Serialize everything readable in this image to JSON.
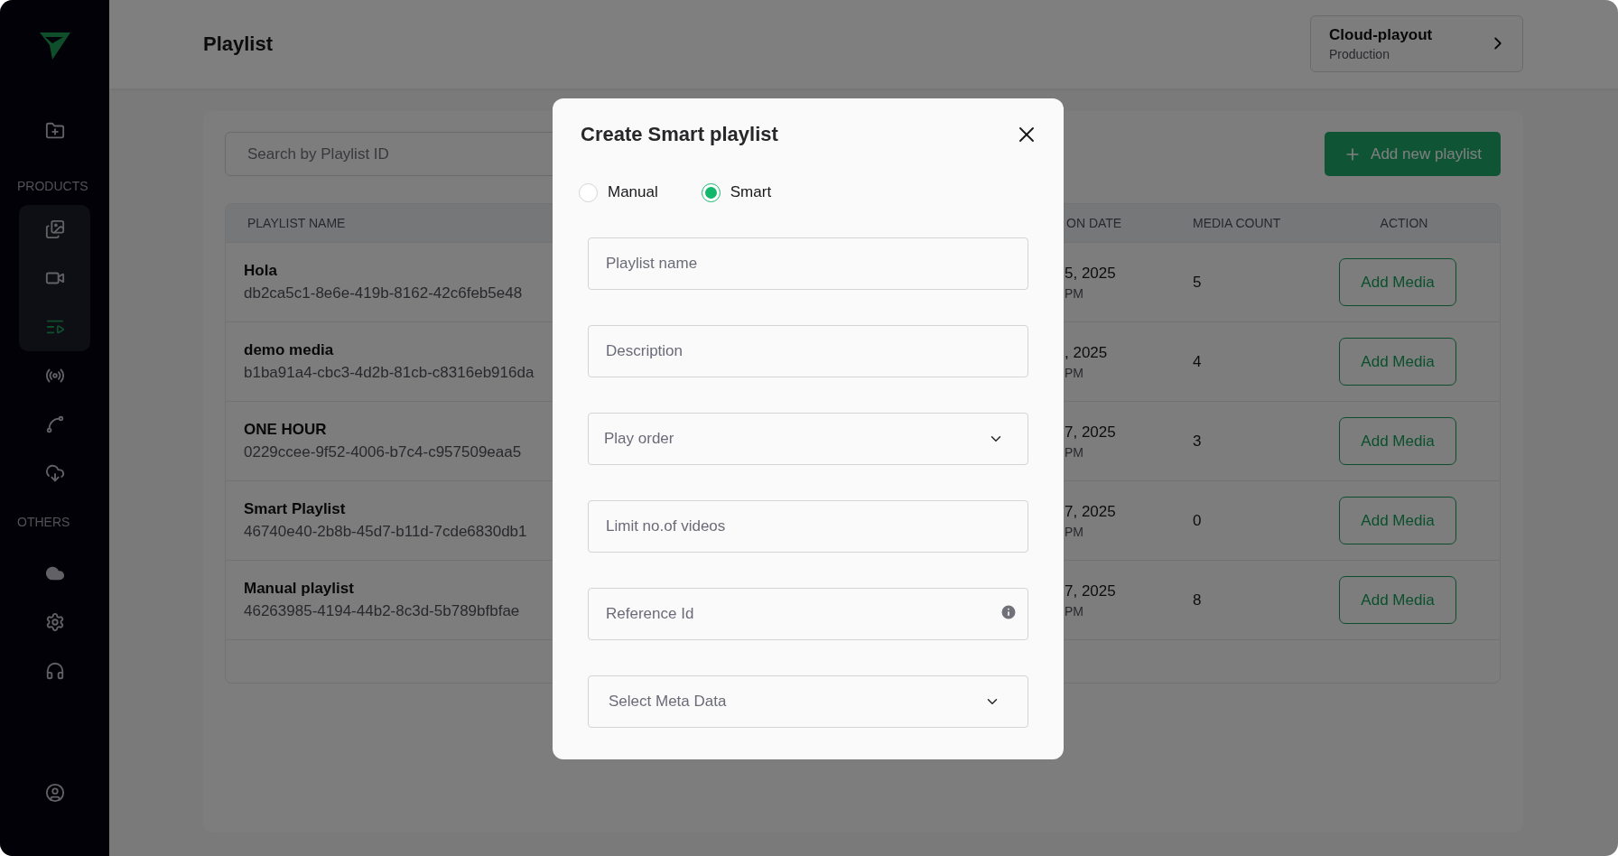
{
  "sidebar": {
    "sections": [
      {
        "label": "PRODUCTS",
        "group": [
          {
            "selected": false
          },
          {
            "selected": false
          },
          {
            "selected": true
          }
        ],
        "items": [
          {
            "selected": false
          },
          {
            "selected": false
          },
          {
            "selected": false
          }
        ]
      },
      {
        "label": "OTHERS",
        "items": [
          {
            "selected": false
          },
          {
            "selected": false
          },
          {
            "selected": false
          }
        ]
      }
    ]
  },
  "header": {
    "title": "Playlist",
    "workspace": {
      "name": "Cloud-playout",
      "environment": "Production"
    }
  },
  "toolbar": {
    "search": {
      "placeholder": "Search by Playlist ID"
    },
    "add_button": "Add new playlist"
  },
  "table": {
    "columns": [
      "PLAYLIST NAME",
      "ON DATE",
      "MEDIA COUNT",
      "ACTION"
    ],
    "rows": [
      {
        "name": "Hola",
        "id": "db2ca5c1-8e6e-419b-8162-42c6feb5e48",
        "date": "5, 2025",
        "time": "PM",
        "media_count": "5",
        "action": "Add Media"
      },
      {
        "name": "demo media",
        "id": "b1ba91a4-cbc3-4d2b-81cb-c8316eb916da",
        "date": ", 2025",
        "time": "PM",
        "media_count": "4",
        "action": "Add Media"
      },
      {
        "name": "ONE HOUR",
        "id": "0229ccee-9f52-4006-b7c4-c957509eaa5",
        "date": "7, 2025",
        "time": "PM",
        "media_count": "3",
        "action": "Add Media"
      },
      {
        "name": "Smart Playlist",
        "id": "46740e40-2b8b-45d7-b11d-7cde6830db1",
        "date": "7, 2025",
        "time": "PM",
        "media_count": "0",
        "action": "Add Media"
      },
      {
        "name": "Manual playlist",
        "id": "46263985-4194-44b2-8c3d-5b789bfbfae",
        "date": "7, 2025",
        "time": "PM",
        "media_count": "8",
        "action": "Add Media"
      }
    ]
  },
  "dialog": {
    "title": "Create Smart playlist",
    "modes": [
      {
        "label": "Manual",
        "selected": false
      },
      {
        "label": "Smart",
        "selected": true
      }
    ],
    "fields": [
      {
        "kind": "text",
        "placeholder": "Playlist name"
      },
      {
        "kind": "text",
        "placeholder": "Description"
      },
      {
        "kind": "select",
        "placeholder": "Play order"
      },
      {
        "kind": "text",
        "placeholder": "Limit no.of videos"
      },
      {
        "kind": "info",
        "placeholder": "Reference Id"
      },
      {
        "kind": "select",
        "placeholder": "Select Meta Data"
      }
    ]
  }
}
